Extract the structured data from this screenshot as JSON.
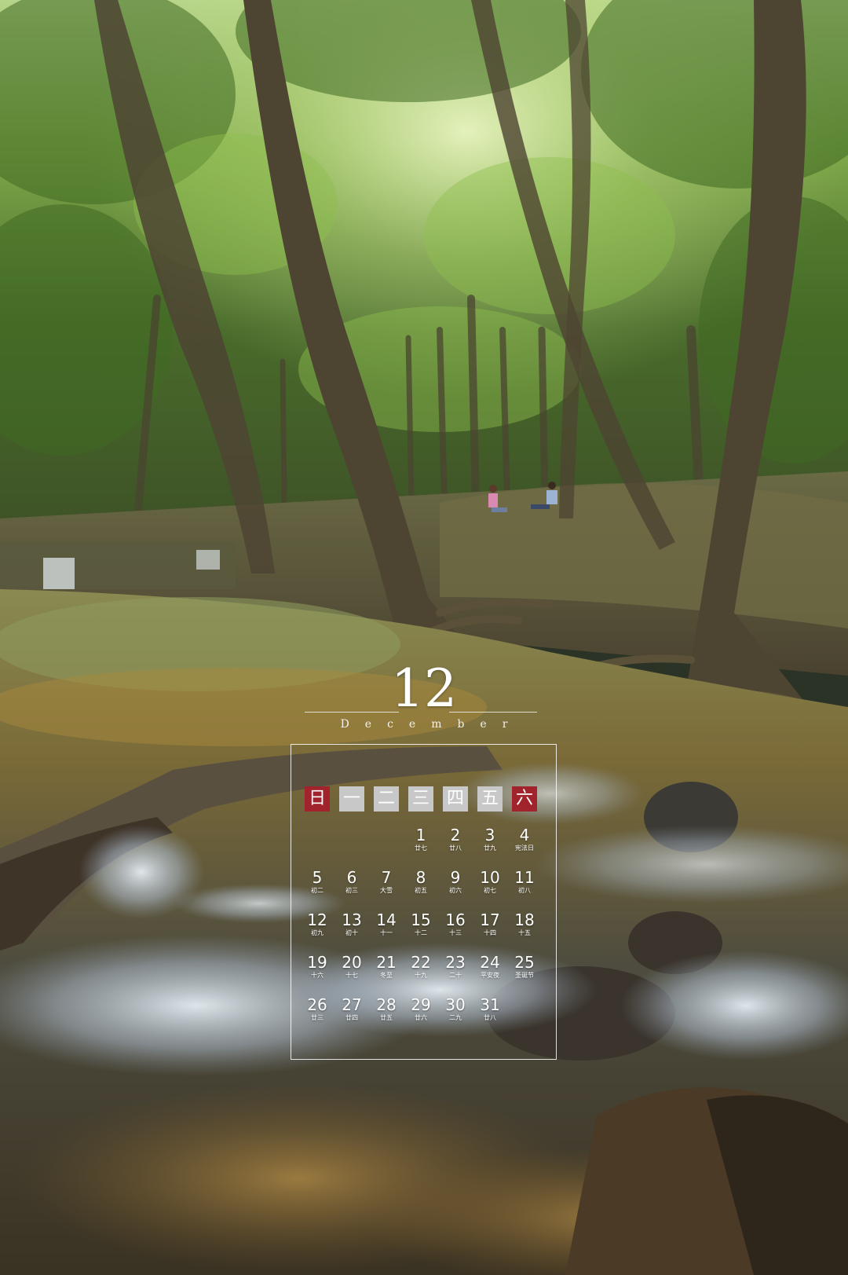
{
  "calendar": {
    "month_number": "12",
    "month_name": "December",
    "weekdays": [
      {
        "label": "日",
        "style": "red"
      },
      {
        "label": "一",
        "style": "gray"
      },
      {
        "label": "二",
        "style": "gray"
      },
      {
        "label": "三",
        "style": "gray"
      },
      {
        "label": "四",
        "style": "gray"
      },
      {
        "label": "五",
        "style": "gray"
      },
      {
        "label": "六",
        "style": "red"
      }
    ],
    "weeks": [
      [
        null,
        null,
        null,
        {
          "day": "1",
          "sub": "廿七"
        },
        {
          "day": "2",
          "sub": "廿八"
        },
        {
          "day": "3",
          "sub": "廿九"
        },
        {
          "day": "4",
          "sub": "宪法日"
        }
      ],
      [
        {
          "day": "5",
          "sub": "初二"
        },
        {
          "day": "6",
          "sub": "初三"
        },
        {
          "day": "7",
          "sub": "大雪"
        },
        {
          "day": "8",
          "sub": "初五"
        },
        {
          "day": "9",
          "sub": "初六"
        },
        {
          "day": "10",
          "sub": "初七"
        },
        {
          "day": "11",
          "sub": "初八"
        }
      ],
      [
        {
          "day": "12",
          "sub": "初九"
        },
        {
          "day": "13",
          "sub": "初十"
        },
        {
          "day": "14",
          "sub": "十一"
        },
        {
          "day": "15",
          "sub": "十二"
        },
        {
          "day": "16",
          "sub": "十三"
        },
        {
          "day": "17",
          "sub": "十四"
        },
        {
          "day": "18",
          "sub": "十五"
        }
      ],
      [
        {
          "day": "19",
          "sub": "十六"
        },
        {
          "day": "20",
          "sub": "十七"
        },
        {
          "day": "21",
          "sub": "冬至"
        },
        {
          "day": "22",
          "sub": "十九"
        },
        {
          "day": "23",
          "sub": "二十"
        },
        {
          "day": "24",
          "sub": "平安夜"
        },
        {
          "day": "25",
          "sub": "圣诞节"
        }
      ],
      [
        {
          "day": "26",
          "sub": "廿三"
        },
        {
          "day": "27",
          "sub": "廿四"
        },
        {
          "day": "28",
          "sub": "廿五"
        },
        {
          "day": "29",
          "sub": "廿六"
        },
        {
          "day": "30",
          "sub": "二九"
        },
        {
          "day": "31",
          "sub": "廿八"
        },
        null
      ]
    ]
  },
  "colors": {
    "accent_red": "#a1232b",
    "weekday_gray": "#c8c8c8",
    "text": "#ffffff"
  }
}
